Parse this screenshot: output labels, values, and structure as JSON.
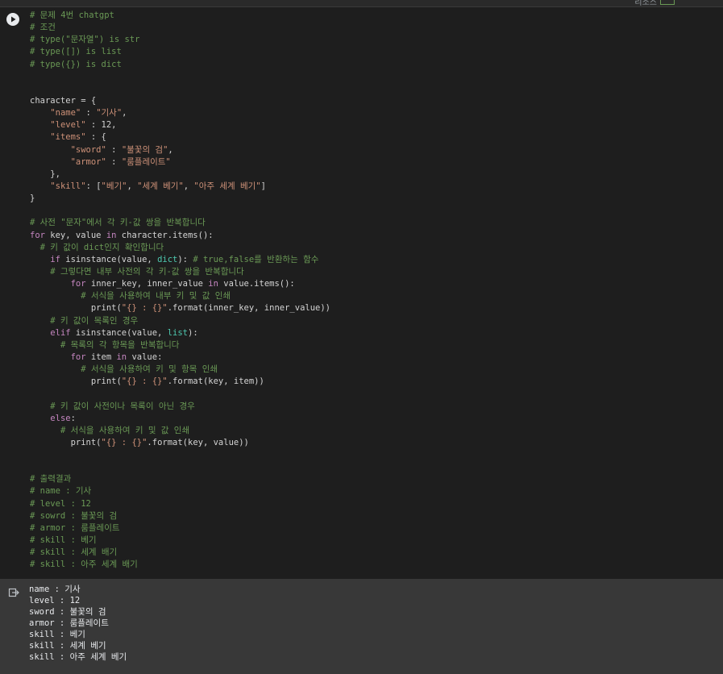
{
  "topbar": {
    "label": "리소스"
  },
  "cell": {
    "run_label": "run-cell",
    "code_lines": [
      [
        {
          "t": "# 문제 4번 chatgpt",
          "c": "com"
        }
      ],
      [
        {
          "t": "# 조건",
          "c": "com"
        }
      ],
      [
        {
          "t": "# type(\"문자열\") is str",
          "c": "com"
        }
      ],
      [
        {
          "t": "# type([]) is list",
          "c": "com"
        }
      ],
      [
        {
          "t": "# type({}) is dict",
          "c": "com"
        }
      ],
      [],
      [],
      [
        {
          "t": "character = {",
          "c": "def"
        }
      ],
      [
        {
          "t": "    ",
          "c": "def"
        },
        {
          "t": "\"name\"",
          "c": "str"
        },
        {
          "t": " : ",
          "c": "def"
        },
        {
          "t": "\"기사\"",
          "c": "str"
        },
        {
          "t": ",",
          "c": "def"
        }
      ],
      [
        {
          "t": "    ",
          "c": "def"
        },
        {
          "t": "\"level\"",
          "c": "str"
        },
        {
          "t": " : 12,",
          "c": "def"
        }
      ],
      [
        {
          "t": "    ",
          "c": "def"
        },
        {
          "t": "\"items\"",
          "c": "str"
        },
        {
          "t": " : {",
          "c": "def"
        }
      ],
      [
        {
          "t": "        ",
          "c": "def"
        },
        {
          "t": "\"sword\"",
          "c": "str"
        },
        {
          "t": " : ",
          "c": "def"
        },
        {
          "t": "\"불꽃의 검\"",
          "c": "str"
        },
        {
          "t": ",",
          "c": "def"
        }
      ],
      [
        {
          "t": "        ",
          "c": "def"
        },
        {
          "t": "\"armor\"",
          "c": "str"
        },
        {
          "t": " : ",
          "c": "def"
        },
        {
          "t": "\"룸플레이트\"",
          "c": "str"
        }
      ],
      [
        {
          "t": "    },",
          "c": "def"
        }
      ],
      [
        {
          "t": "    ",
          "c": "def"
        },
        {
          "t": "\"skill\"",
          "c": "str"
        },
        {
          "t": ": [",
          "c": "def"
        },
        {
          "t": "\"베기\"",
          "c": "str"
        },
        {
          "t": ", ",
          "c": "def"
        },
        {
          "t": "\"세계 베기\"",
          "c": "str"
        },
        {
          "t": ", ",
          "c": "def"
        },
        {
          "t": "\"아주 세계 베기\"",
          "c": "str"
        },
        {
          "t": "]",
          "c": "def"
        }
      ],
      [
        {
          "t": "}",
          "c": "def"
        }
      ],
      [],
      [
        {
          "t": "# 사전 \"문자\"에서 각 키-값 쌍을 반복합니다",
          "c": "com"
        }
      ],
      [
        {
          "t": "for",
          "c": "kw"
        },
        {
          "t": " key, value ",
          "c": "def"
        },
        {
          "t": "in",
          "c": "kw"
        },
        {
          "t": " character.items():",
          "c": "def"
        }
      ],
      [
        {
          "t": "  ",
          "c": "def"
        },
        {
          "t": "# 키 값이 dict인지 확인합니다",
          "c": "com"
        }
      ],
      [
        {
          "t": "    ",
          "c": "def"
        },
        {
          "t": "if",
          "c": "kw"
        },
        {
          "t": " isinstance(value, ",
          "c": "def"
        },
        {
          "t": "dict",
          "c": "bi"
        },
        {
          "t": "): ",
          "c": "def"
        },
        {
          "t": "# true,false를 반환하는 함수",
          "c": "com"
        }
      ],
      [
        {
          "t": "    ",
          "c": "def"
        },
        {
          "t": "# 그렇다면 내부 사전의 각 키-값 쌍을 반복합니다",
          "c": "com"
        }
      ],
      [
        {
          "t": "        ",
          "c": "def"
        },
        {
          "t": "for",
          "c": "kw"
        },
        {
          "t": " inner_key, inner_value ",
          "c": "def"
        },
        {
          "t": "in",
          "c": "kw"
        },
        {
          "t": " value.items():",
          "c": "def"
        }
      ],
      [
        {
          "t": "          ",
          "c": "def"
        },
        {
          "t": "# 서식을 사용하여 내부 키 및 값 인쇄",
          "c": "com"
        }
      ],
      [
        {
          "t": "            print(",
          "c": "def"
        },
        {
          "t": "\"{} : {}\"",
          "c": "str"
        },
        {
          "t": ".format(inner_key, inner_value))",
          "c": "def"
        }
      ],
      [
        {
          "t": "    ",
          "c": "def"
        },
        {
          "t": "# 키 값이 목록인 경우",
          "c": "com"
        }
      ],
      [
        {
          "t": "    ",
          "c": "def"
        },
        {
          "t": "elif",
          "c": "kw"
        },
        {
          "t": " isinstance(value, ",
          "c": "def"
        },
        {
          "t": "list",
          "c": "bi"
        },
        {
          "t": "):",
          "c": "def"
        }
      ],
      [
        {
          "t": "      ",
          "c": "def"
        },
        {
          "t": "# 목록의 각 항목을 반복합니다",
          "c": "com"
        }
      ],
      [
        {
          "t": "        ",
          "c": "def"
        },
        {
          "t": "for",
          "c": "kw"
        },
        {
          "t": " item ",
          "c": "def"
        },
        {
          "t": "in",
          "c": "kw"
        },
        {
          "t": " value:",
          "c": "def"
        }
      ],
      [
        {
          "t": "          ",
          "c": "def"
        },
        {
          "t": "# 서식을 사용하여 키 및 항목 인쇄",
          "c": "com"
        }
      ],
      [
        {
          "t": "            print(",
          "c": "def"
        },
        {
          "t": "\"{} : {}\"",
          "c": "str"
        },
        {
          "t": ".format(key, item))",
          "c": "def"
        }
      ],
      [],
      [
        {
          "t": "    ",
          "c": "def"
        },
        {
          "t": "# 키 값이 사전이나 목록이 아닌 경우",
          "c": "com"
        }
      ],
      [
        {
          "t": "    ",
          "c": "def"
        },
        {
          "t": "else",
          "c": "kw"
        },
        {
          "t": ":",
          "c": "def"
        }
      ],
      [
        {
          "t": "      ",
          "c": "def"
        },
        {
          "t": "# 서식을 사용하여 키 및 값 인쇄",
          "c": "com"
        }
      ],
      [
        {
          "t": "        print(",
          "c": "def"
        },
        {
          "t": "\"{} : {}\"",
          "c": "str"
        },
        {
          "t": ".format(key, value))",
          "c": "def"
        }
      ],
      [],
      [],
      [
        {
          "t": "# 출력결과",
          "c": "com"
        }
      ],
      [
        {
          "t": "# name : 기사",
          "c": "com"
        }
      ],
      [
        {
          "t": "# level : 12",
          "c": "com"
        }
      ],
      [
        {
          "t": "# sowrd : 불꽃의 검",
          "c": "com"
        }
      ],
      [
        {
          "t": "# armor : 룸플레이트",
          "c": "com"
        }
      ],
      [
        {
          "t": "# skill : 베기",
          "c": "com"
        }
      ],
      [
        {
          "t": "# skill : 세계 배기",
          "c": "com"
        }
      ],
      [
        {
          "t": "# skill : 아주 세계 배기",
          "c": "com"
        }
      ]
    ]
  },
  "output": {
    "lines": [
      "name : 기사",
      "level : 12",
      "sword : 불꽃의 검",
      "armor : 룸플레이트",
      "skill : 베기",
      "skill : 세계 베기",
      "skill : 아주 세계 베기"
    ]
  },
  "colors": {
    "comment": "#6a9955",
    "string": "#ce9178",
    "keyword": "#c586c0",
    "builtin": "#4ec9b0",
    "default": "#d4d4d4",
    "cell_bg": "#1e1e1e",
    "output_bg": "#383838"
  },
  "icons": {
    "run": "play-circle-icon",
    "output": "output-arrow-icon"
  }
}
